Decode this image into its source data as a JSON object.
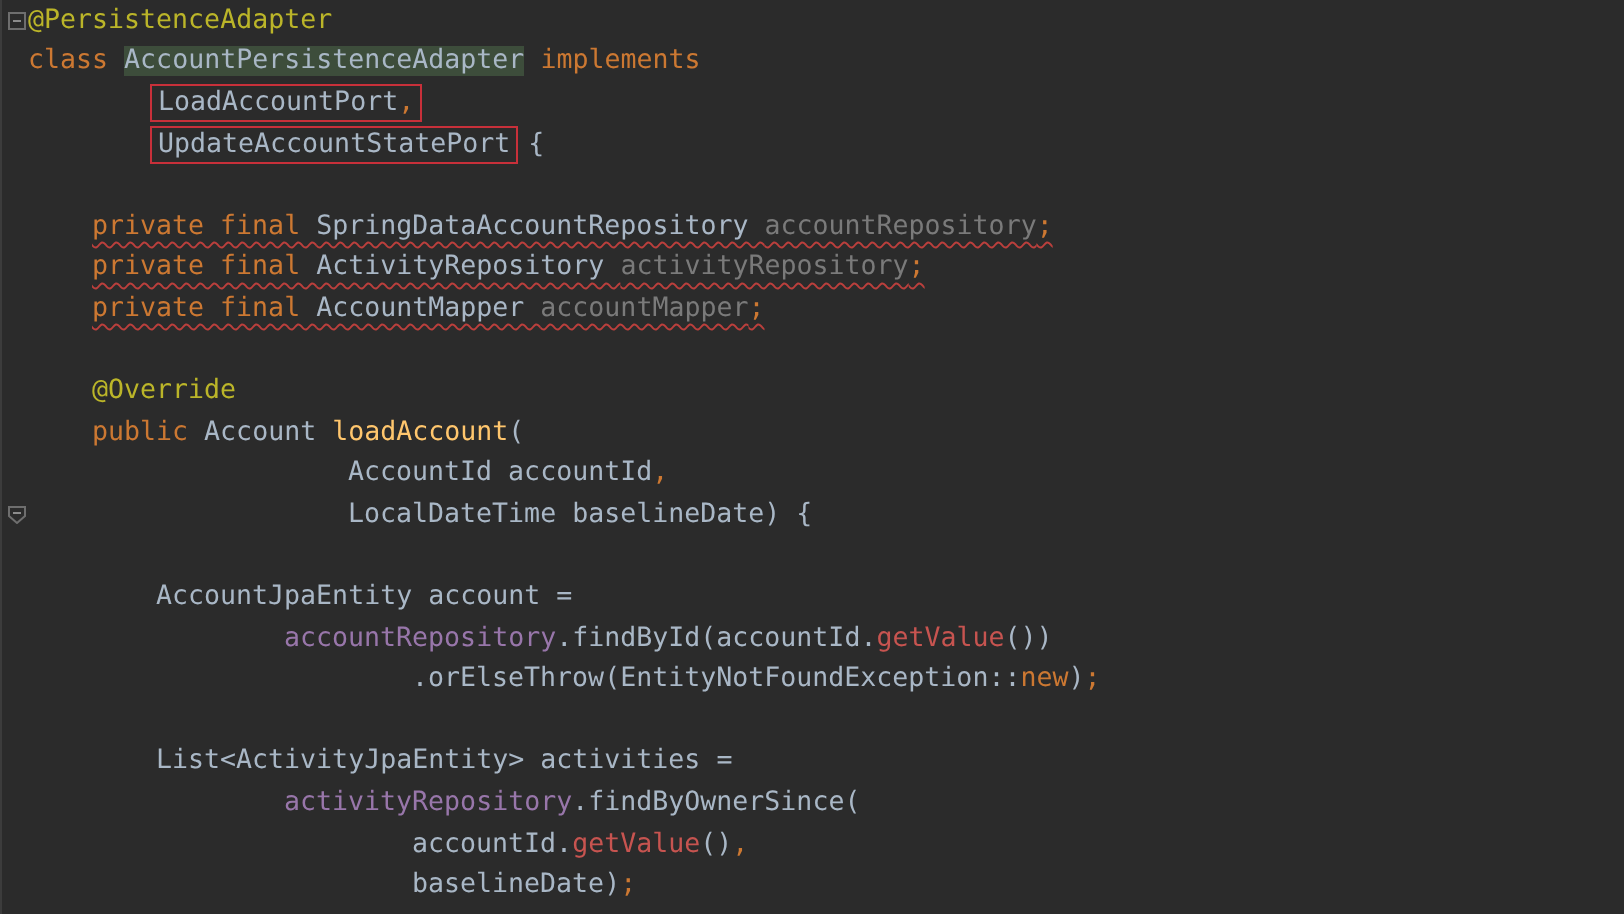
{
  "editor": {
    "lines": [
      {
        "kind": "top",
        "squiggle": false,
        "fold_start": true,
        "tokens": [
          {
            "text": "@PersistenceAdapter",
            "kind": "annotation"
          }
        ]
      },
      {
        "kind": "top",
        "squiggle": false,
        "tokens": [
          {
            "text": "class ",
            "kind": "keyword"
          },
          {
            "text": "AccountPersistenceAdapter",
            "kind": "plain",
            "highlighted": true
          },
          {
            "text": " implements",
            "kind": "keyword"
          }
        ]
      },
      {
        "kind": "body",
        "squiggle": false,
        "tokens": [
          {
            "boxed": true,
            "parts": [
              {
                "text": "LoadAccountPort",
                "kind": "plain"
              },
              {
                "text": ",",
                "kind": "punct"
              }
            ]
          }
        ]
      },
      {
        "kind": "body",
        "squiggle": false,
        "tokens": [
          {
            "boxed": true,
            "parts": [
              {
                "text": "UpdateAccountStatePort",
                "kind": "plain"
              }
            ]
          },
          {
            "text": " {",
            "kind": "plain"
          }
        ]
      },
      {
        "kind": "top"
      },
      {
        "kind": "member",
        "squiggle": true,
        "tokens": [
          {
            "text": "private final ",
            "kind": "keyword"
          },
          {
            "text": "SpringDataAccountRepository ",
            "kind": "plain"
          },
          {
            "text": "accountRepository",
            "kind": "unused"
          },
          {
            "text": ";",
            "kind": "punct"
          }
        ]
      },
      {
        "kind": "member",
        "squiggle": true,
        "tokens": [
          {
            "text": "private final ",
            "kind": "keyword"
          },
          {
            "text": "ActivityRepository ",
            "kind": "plain"
          },
          {
            "text": "activityRepository",
            "kind": "unused"
          },
          {
            "text": ";",
            "kind": "punct"
          }
        ]
      },
      {
        "kind": "member",
        "squiggle": true,
        "tokens": [
          {
            "text": "private final ",
            "kind": "keyword"
          },
          {
            "text": "AccountMapper ",
            "kind": "plain"
          },
          {
            "text": "accountMapper",
            "kind": "unused"
          },
          {
            "text": ";",
            "kind": "punct"
          }
        ]
      },
      {
        "kind": "top"
      },
      {
        "kind": "member",
        "squiggle": false,
        "tokens": [
          {
            "text": "@Override",
            "kind": "annotation"
          }
        ]
      },
      {
        "kind": "member",
        "squiggle": false,
        "tokens": [
          {
            "text": "public ",
            "kind": "keyword"
          },
          {
            "text": "Account ",
            "kind": "plain"
          },
          {
            "text": "loadAccount",
            "kind": "method"
          },
          {
            "text": "(",
            "kind": "plain"
          }
        ]
      },
      {
        "kind": "param",
        "squiggle": false,
        "tokens": [
          {
            "text": "AccountId accountId",
            "kind": "plain"
          },
          {
            "text": ",",
            "kind": "punct"
          }
        ]
      },
      {
        "kind": "param",
        "squiggle": false,
        "fold_end": true,
        "tokens": [
          {
            "text": "LocalDateTime baselineDate) {",
            "kind": "plain"
          }
        ]
      },
      {
        "kind": "top"
      },
      {
        "kind": "body",
        "squiggle": false,
        "tokens": [
          {
            "text": "AccountJpaEntity account =",
            "kind": "plain"
          }
        ]
      },
      {
        "kind": "wrap",
        "squiggle": false,
        "tokens": [
          {
            "text": "accountRepository",
            "kind": "field"
          },
          {
            "text": ".findById(accountId.",
            "kind": "plain"
          },
          {
            "text": "getValue",
            "kind": "call"
          },
          {
            "text": "())",
            "kind": "plain"
          }
        ]
      },
      {
        "kind": "chain",
        "squiggle": false,
        "tokens": [
          {
            "text": ".orElseThrow(EntityNotFoundException::",
            "kind": "plain"
          },
          {
            "text": "new",
            "kind": "keyword"
          },
          {
            "text": ")",
            "kind": "plain"
          },
          {
            "text": ";",
            "kind": "punct"
          }
        ]
      },
      {
        "kind": "top"
      },
      {
        "kind": "body",
        "squiggle": false,
        "tokens": [
          {
            "text": "List<ActivityJpaEntity> activities =",
            "kind": "plain"
          }
        ]
      },
      {
        "kind": "wrap",
        "squiggle": false,
        "tokens": [
          {
            "text": "activityRepository",
            "kind": "field"
          },
          {
            "text": ".findByOwnerSince(",
            "kind": "plain"
          }
        ]
      },
      {
        "kind": "chain",
        "squiggle": false,
        "tokens": [
          {
            "text": "accountId.",
            "kind": "plain"
          },
          {
            "text": "getValue",
            "kind": "call"
          },
          {
            "text": "()",
            "kind": "plain"
          },
          {
            "text": ",",
            "kind": "punct"
          }
        ]
      },
      {
        "kind": "chain",
        "squiggle": false,
        "tokens": [
          {
            "text": "baselineDate)",
            "kind": "plain"
          },
          {
            "text": ";",
            "kind": "punct"
          }
        ]
      }
    ]
  }
}
